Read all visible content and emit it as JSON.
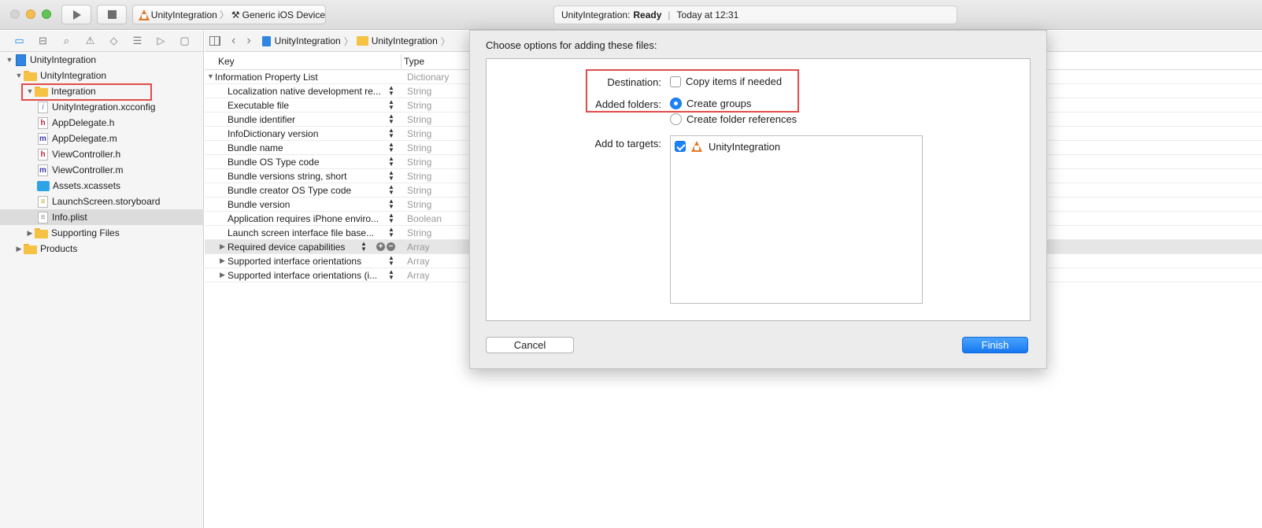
{
  "toolbar": {
    "scheme_name": "UnityIntegration",
    "device_name": "Generic iOS Device",
    "activity_project": "UnityIntegration:",
    "activity_status": "Ready",
    "activity_time": "Today at 12:31"
  },
  "navigator": {
    "items": [
      {
        "label": "UnityIntegration"
      },
      {
        "label": "UnityIntegration"
      },
      {
        "label": "Integration"
      },
      {
        "label": "UnityIntegration.xcconfig"
      },
      {
        "label": "AppDelegate.h"
      },
      {
        "label": "AppDelegate.m"
      },
      {
        "label": "ViewController.h"
      },
      {
        "label": "ViewController.m"
      },
      {
        "label": "Assets.xcassets"
      },
      {
        "label": "LaunchScreen.storyboard"
      },
      {
        "label": "Info.plist"
      },
      {
        "label": "Supporting Files"
      },
      {
        "label": "Products"
      }
    ]
  },
  "jumpbar": {
    "crumb_project": "UnityIntegration",
    "crumb_group": "UnityIntegration"
  },
  "plist": {
    "header_key": "Key",
    "header_type": "Type",
    "rows": [
      {
        "key": "Information Property List",
        "type": "Dictionary"
      },
      {
        "key": "Localization native development re...",
        "type": "String"
      },
      {
        "key": "Executable file",
        "type": "String"
      },
      {
        "key": "Bundle identifier",
        "type": "String"
      },
      {
        "key": "InfoDictionary version",
        "type": "String"
      },
      {
        "key": "Bundle name",
        "type": "String"
      },
      {
        "key": "Bundle OS Type code",
        "type": "String"
      },
      {
        "key": "Bundle versions string, short",
        "type": "String"
      },
      {
        "key": "Bundle creator OS Type code",
        "type": "String"
      },
      {
        "key": "Bundle version",
        "type": "String"
      },
      {
        "key": "Application requires iPhone enviro...",
        "type": "Boolean"
      },
      {
        "key": "Launch screen interface file base...",
        "type": "String"
      },
      {
        "key": "Required device capabilities",
        "type": "Array"
      },
      {
        "key": "Supported interface orientations",
        "type": "Array"
      },
      {
        "key": "Supported interface orientations (i...",
        "type": "Array"
      }
    ]
  },
  "dialog": {
    "title": "Choose options for adding these files:",
    "destination_label": "Destination:",
    "copy_items_label": "Copy items if needed",
    "copy_items_checked": false,
    "added_folders_label": "Added folders:",
    "create_groups_label": "Create groups",
    "create_folder_refs_label": "Create folder references",
    "selected_folder_option": "Create groups",
    "add_to_targets_label": "Add to targets:",
    "target_name": "UnityIntegration",
    "target_checked": true,
    "cancel_label": "Cancel",
    "finish_label": "Finish"
  },
  "colors": {
    "accent": "#1a82fb",
    "highlight_box": "#e24b4b",
    "folder": "#f6c244"
  }
}
